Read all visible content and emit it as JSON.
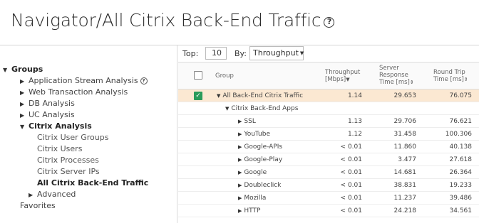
{
  "header": {
    "title": "Navigator/All Citrix Back-End Traffic"
  },
  "sidebar": {
    "items": [
      {
        "label": "Groups",
        "indicator": "triangle-down",
        "bold": true
      },
      {
        "label": "Application Stream Analysis",
        "indicator": "triangle-right",
        "help": true
      },
      {
        "label": "Web Transaction Analysis",
        "indicator": "triangle-right"
      },
      {
        "label": "DB Analysis",
        "indicator": "triangle-right"
      },
      {
        "label": "UC Analysis",
        "indicator": "triangle-right"
      },
      {
        "label": "Citrix Analysis",
        "indicator": "triangle-down",
        "bold": true
      },
      {
        "label": "Citrix User Groups"
      },
      {
        "label": "Citrix Users"
      },
      {
        "label": "Citrix Processes"
      },
      {
        "label": "Citrix Server IPs"
      },
      {
        "label": "All Citrix Back-End Traffic",
        "bold": true,
        "selected": true
      },
      {
        "label": "Advanced",
        "indicator": "triangle-right"
      },
      {
        "label": "Favorites"
      }
    ]
  },
  "toolbar": {
    "top_label": "Top:",
    "top_value": "10",
    "by_label": "By:",
    "by_value": "Throughput"
  },
  "table": {
    "headers": {
      "group": "Group",
      "throughput": [
        "Throughput",
        "[Mbps]"
      ],
      "server_response": [
        "Server",
        "Response",
        "Time [ms]"
      ],
      "round_trip": [
        "Round Trip",
        "Time [ms]"
      ]
    },
    "rows": [
      {
        "name": "All Back-End Citrix Traffic",
        "throughput": "1.14",
        "server_response": "29.653",
        "round_trip": "76.075"
      },
      {
        "name": "Citrix Back-End Apps",
        "throughput": "",
        "server_response": "",
        "round_trip": ""
      },
      {
        "name": "SSL",
        "throughput": "1.13",
        "server_response": "29.706",
        "round_trip": "76.621"
      },
      {
        "name": "YouTube",
        "throughput": "1.12",
        "server_response": "31.458",
        "round_trip": "100.306"
      },
      {
        "name": "Google-APIs",
        "throughput": "< 0.01",
        "server_response": "11.860",
        "round_trip": "40.138"
      },
      {
        "name": "Google-Play",
        "throughput": "< 0.01",
        "server_response": "3.477",
        "round_trip": "27.618"
      },
      {
        "name": "Google",
        "throughput": "< 0.01",
        "server_response": "14.681",
        "round_trip": "26.364"
      },
      {
        "name": "Doubleclick",
        "throughput": "< 0.01",
        "server_response": "38.831",
        "round_trip": "19.233"
      },
      {
        "name": "Mozilla",
        "throughput": "< 0.01",
        "server_response": "11.237",
        "round_trip": "39.486"
      },
      {
        "name": "HTTP",
        "throughput": "< 0.01",
        "server_response": "24.218",
        "round_trip": "34.561"
      }
    ]
  },
  "colors": {
    "highlight": "#fbe8d2",
    "checkbox_checked": "#2a9b5b"
  }
}
